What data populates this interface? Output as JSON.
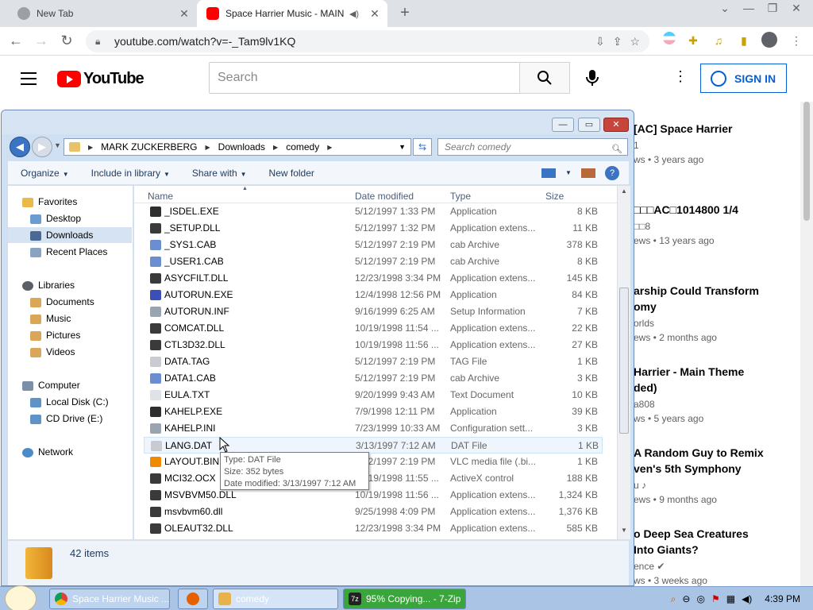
{
  "browser": {
    "tabs": [
      {
        "title": "New Tab",
        "active": false
      },
      {
        "title": "Space Harrier Music - MAIN",
        "active": true
      }
    ],
    "url": "youtube.com/watch?v=-_Tam9lv1KQ"
  },
  "youtube": {
    "logo": "YouTube",
    "search_placeholder": "Search",
    "signin_label": "SIGN IN",
    "recommendations": [
      {
        "title": "[AC] Space Harrier",
        "channel": "1",
        "meta": "ws • 3 years ago"
      },
      {
        "title": "□□□AC□1014800    1/4",
        "channel": "□□8",
        "meta": "ews • 13 years ago"
      },
      {
        "title": "arship Could Transform\nomy",
        "channel": "orlds",
        "meta": "ews • 2 months ago"
      },
      {
        "title": "Harrier - Main Theme\nded)",
        "channel": "a808",
        "meta": "ws • 5 years ago"
      },
      {
        "title": "A Random Guy to Remix\nven's 5th Symphony",
        "channel": "u ♪",
        "meta": "ews • 9 months ago"
      },
      {
        "title": "o Deep Sea Creatures\nInto Giants?",
        "channel": "ence ✔",
        "meta": "ws • 3 weeks ago"
      }
    ]
  },
  "explorer": {
    "breadcrumb": [
      "MARK ZUCKERBERG",
      "Downloads",
      "comedy"
    ],
    "search_placeholder": "Search comedy",
    "commands": [
      "Organize",
      "Include in library",
      "Share with",
      "New folder"
    ],
    "nav": {
      "favorites": "Favorites",
      "favorites_items": [
        "Desktop",
        "Downloads",
        "Recent Places"
      ],
      "libraries": "Libraries",
      "libraries_items": [
        "Documents",
        "Music",
        "Pictures",
        "Videos"
      ],
      "computer": "Computer",
      "computer_items": [
        "Local Disk (C:)",
        "CD Drive (E:)"
      ],
      "network": "Network"
    },
    "columns": {
      "name": "Name",
      "date": "Date modified",
      "type": "Type",
      "size": "Size"
    },
    "files": [
      {
        "name": "_ISDEL.EXE",
        "date": "5/12/1997 1:33 PM",
        "type": "Application",
        "size": "8 KB",
        "icon": "exe"
      },
      {
        "name": "_SETUP.DLL",
        "date": "5/12/1997 1:32 PM",
        "type": "Application extens...",
        "size": "11 KB",
        "icon": "dll"
      },
      {
        "name": "_SYS1.CAB",
        "date": "5/12/1997 2:19 PM",
        "type": "cab Archive",
        "size": "378 KB",
        "icon": "cab"
      },
      {
        "name": "_USER1.CAB",
        "date": "5/12/1997 2:19 PM",
        "type": "cab Archive",
        "size": "8 KB",
        "icon": "cab"
      },
      {
        "name": "ASYCFILT.DLL",
        "date": "12/23/1998 3:34 PM",
        "type": "Application extens...",
        "size": "145 KB",
        "icon": "dll"
      },
      {
        "name": "AUTORUN.EXE",
        "date": "12/4/1998 12:56 PM",
        "type": "Application",
        "size": "84 KB",
        "icon": "autorun"
      },
      {
        "name": "AUTORUN.INF",
        "date": "9/16/1999 6:25 AM",
        "type": "Setup Information",
        "size": "7 KB",
        "icon": "inf"
      },
      {
        "name": "COMCAT.DLL",
        "date": "10/19/1998 11:54 ...",
        "type": "Application extens...",
        "size": "22 KB",
        "icon": "dll"
      },
      {
        "name": "CTL3D32.DLL",
        "date": "10/19/1998 11:56 ...",
        "type": "Application extens...",
        "size": "27 KB",
        "icon": "dll"
      },
      {
        "name": "DATA.TAG",
        "date": "5/12/1997 2:19 PM",
        "type": "TAG File",
        "size": "1 KB",
        "icon": "file"
      },
      {
        "name": "DATA1.CAB",
        "date": "5/12/1997 2:19 PM",
        "type": "cab Archive",
        "size": "3 KB",
        "icon": "cab"
      },
      {
        "name": "EULA.TXT",
        "date": "9/20/1999 9:43 AM",
        "type": "Text Document",
        "size": "10 KB",
        "icon": "txt"
      },
      {
        "name": "KAHELP.EXE",
        "date": "7/9/1998 12:11 PM",
        "type": "Application",
        "size": "39 KB",
        "icon": "exe"
      },
      {
        "name": "KAHELP.INI",
        "date": "7/23/1999 10:33 AM",
        "type": "Configuration sett...",
        "size": "3 KB",
        "icon": "inf"
      },
      {
        "name": "LANG.DAT",
        "date": "3/13/1997 7:12 AM",
        "type": "DAT File",
        "size": "1 KB",
        "icon": "file",
        "hover": true
      },
      {
        "name": "LAYOUT.BIN",
        "date": "5/12/1997 2:19 PM",
        "type": "VLC media file (.bi...",
        "size": "1 KB",
        "icon": "vlc"
      },
      {
        "name": "MCI32.OCX",
        "date": "10/19/1998 11:55 ...",
        "type": "ActiveX control",
        "size": "188 KB",
        "icon": "dll"
      },
      {
        "name": "MSVBVM50.DLL",
        "date": "10/19/1998 11:56 ...",
        "type": "Application extens...",
        "size": "1,324 KB",
        "icon": "dll"
      },
      {
        "name": "msvbvm60.dll",
        "date": "9/25/1998 4:09 PM",
        "type": "Application extens...",
        "size": "1,376 KB",
        "icon": "dll"
      },
      {
        "name": "OLEAUT32.DLL",
        "date": "12/23/1998 3:34 PM",
        "type": "Application extens...",
        "size": "585 KB",
        "icon": "dll"
      }
    ],
    "item_count": "42 items",
    "tooltip": [
      "Type: DAT File",
      "Size: 352 bytes",
      "Date modified: 3/13/1997 7:12 AM"
    ]
  },
  "taskbar": {
    "buttons": [
      "Space Harrier Music ...",
      "comedy",
      "95% Copying... - 7-Zip"
    ],
    "clock": "4:39 PM"
  },
  "colors": {
    "yt_red": "#ff0000",
    "signin_blue": "#065fd4",
    "explorer_frame": "#cfe0f2",
    "taskbar": "#a9c4e4",
    "progress_green": "#3aa53a"
  }
}
